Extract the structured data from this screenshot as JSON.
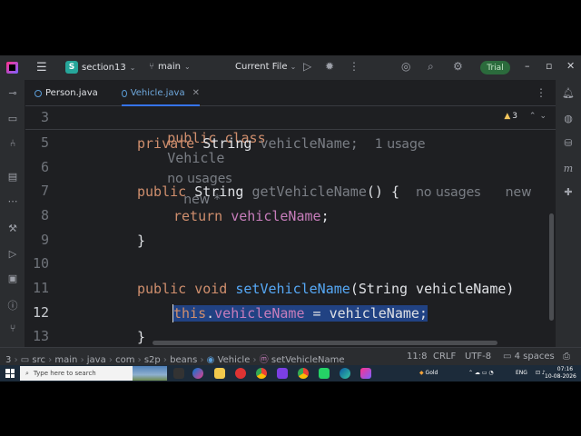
{
  "titlebar": {
    "project_initial": "S",
    "project": "section13",
    "branch": "main",
    "run_config": "Current File",
    "trial": "Trial"
  },
  "tabs": [
    {
      "label": "Person.java",
      "active": false
    },
    {
      "label": "Vehicle.java",
      "active": true
    }
  ],
  "editor": {
    "warnings": "3",
    "sticky": {
      "line": "3",
      "kw": "public class",
      "name": "Vehicle",
      "hint1": "no usages",
      "hint2": "new *"
    },
    "lines": [
      {
        "num": "5",
        "tokens": [
          "private",
          "String",
          "vehicleName;"
        ],
        "hint": "1 usage"
      },
      {
        "num": "6"
      },
      {
        "num": "7",
        "tokens": [
          "public",
          "String",
          "getVehicleName",
          "() {"
        ],
        "hint": "no usages",
        "hint2": "new"
      },
      {
        "num": "8",
        "tokens": [
          "return",
          "vehicleName",
          ";"
        ]
      },
      {
        "num": "9",
        "tokens": [
          "}"
        ]
      },
      {
        "num": "10"
      },
      {
        "num": "11",
        "tokens": [
          "public void",
          "setVehicleName",
          "(String vehicleName)"
        ]
      },
      {
        "num": "12",
        "tokens": [
          "this",
          ".",
          "vehicleName",
          " = vehicleName;"
        ]
      },
      {
        "num": "13",
        "tokens": [
          "}"
        ]
      }
    ]
  },
  "statusbar": {
    "breadcrumbs": [
      "3",
      "src",
      "main",
      "java",
      "com",
      "s2p",
      "beans",
      "Vehicle",
      "setVehicleName"
    ],
    "position": "11:8",
    "line_sep": "CRLF",
    "encoding": "UTF-8",
    "indent": "4 spaces"
  },
  "taskbar": {
    "search_placeholder": "Type here to search",
    "weather": "Gold",
    "lang": "ENG",
    "time": "07:16",
    "date": "10-08-2026"
  }
}
